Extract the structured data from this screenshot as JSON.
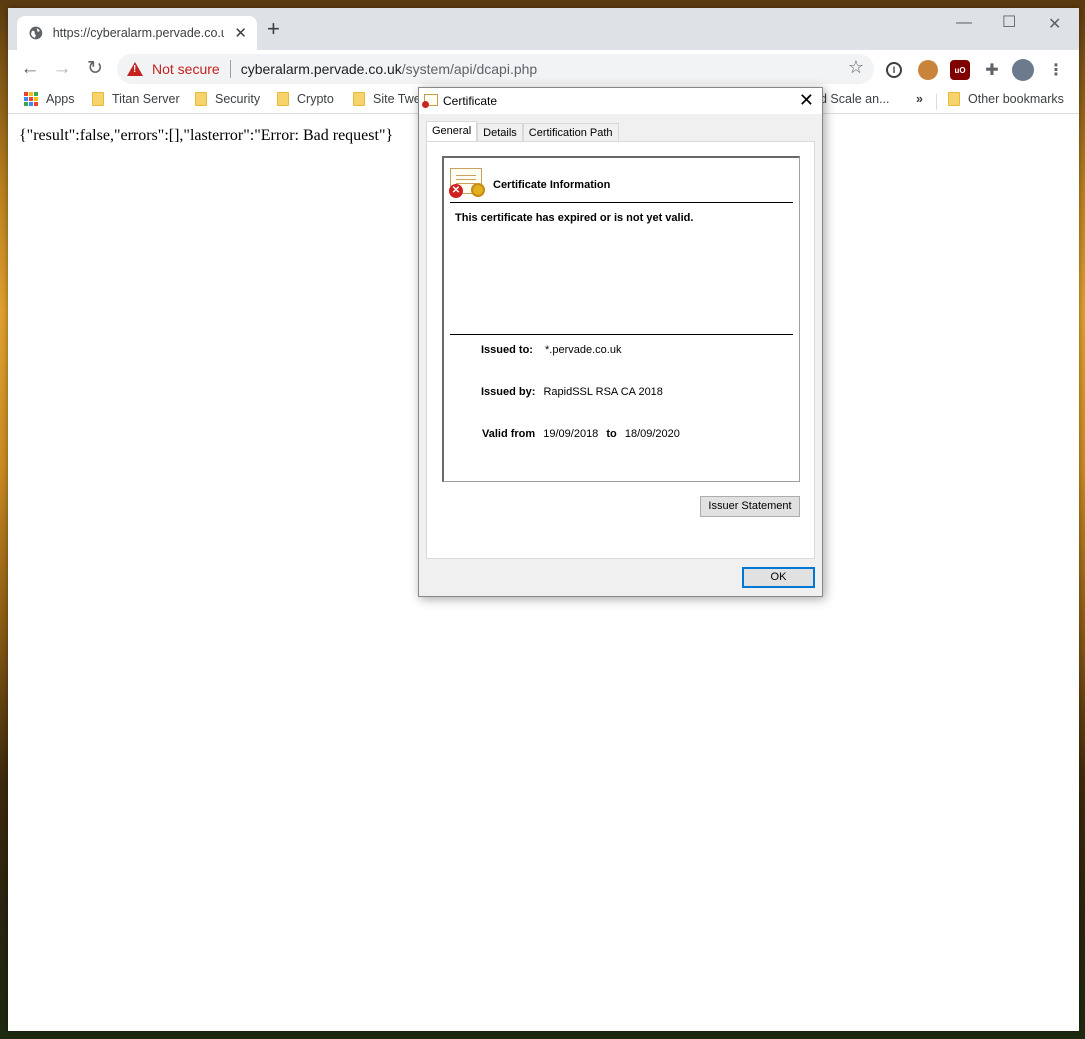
{
  "browser": {
    "tab_title": "https://cyberalarm.pervade.co.uk",
    "new_tab_label": "+",
    "security_label": "Not secure",
    "url_host": "cyberalarm.pervade.co.uk",
    "url_path": "/system/api/dcapi.php",
    "bookmarks": [
      {
        "label": "Apps"
      },
      {
        "label": "Titan Server"
      },
      {
        "label": "Security"
      },
      {
        "label": "Crypto"
      },
      {
        "label": "Site Twe"
      },
      {
        "label": "d Scale an..."
      }
    ],
    "more_bookmarks": "»",
    "other_bookmarks": "Other bookmarks"
  },
  "page": {
    "body_text": "{\"result\":false,\"errors\":[],\"lasterror\":\"Error: Bad request\"}"
  },
  "dialog": {
    "title": "Certificate",
    "tabs": [
      "General",
      "Details",
      "Certification Path"
    ],
    "info_title": "Certificate Information",
    "message": "This certificate has expired or is not yet valid.",
    "issued_to_label": "Issued to:",
    "issued_to": "*.pervade.co.uk",
    "issued_by_label": "Issued by:",
    "issued_by": "RapidSSL RSA CA 2018",
    "valid_from_label": "Valid from",
    "valid_from": "19/09/2018",
    "to_label": "to",
    "valid_to": "18/09/2020",
    "issuer_statement_button": "Issuer Statement",
    "ok_button": "OK"
  }
}
